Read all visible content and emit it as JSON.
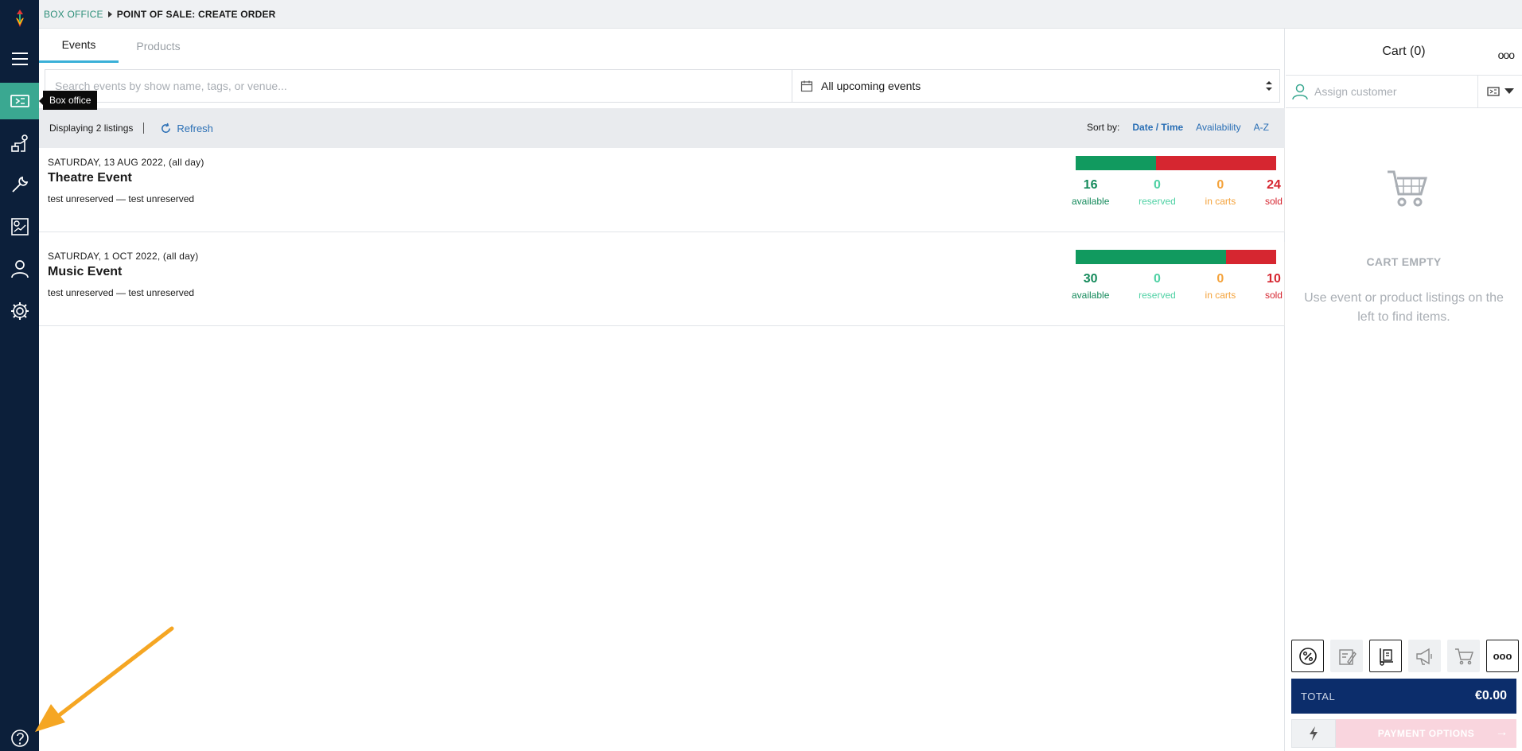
{
  "sidebar": {
    "tooltip": "Box office"
  },
  "breadcrumb": {
    "parent": "BOX OFFICE",
    "current": "POINT OF SALE: CREATE ORDER"
  },
  "tabs": [
    {
      "label": "Events"
    },
    {
      "label": "Products"
    }
  ],
  "search": {
    "placeholder": "Search events by show name, tags, or venue...",
    "value": ""
  },
  "event_filter": {
    "selected": "All upcoming events"
  },
  "listbar": {
    "count_text": "Displaying 2 listings",
    "refresh_label": "Refresh",
    "sort_label": "Sort by:",
    "sort_options": [
      "Date / Time",
      "Availability",
      "A-Z"
    ],
    "sort_active": "Date / Time"
  },
  "events": [
    {
      "date": "SATURDAY, 13 AUG 2022,",
      "time": "(all day)",
      "name": "Theatre Event",
      "venue": "test unreserved — test unreserved",
      "available": "16",
      "reserved": "0",
      "in_carts": "0",
      "sold": "24",
      "available_fraction": 0.4
    },
    {
      "date": "SATURDAY, 1 OCT 2022,",
      "time": "(all day)",
      "name": "Music Event",
      "venue": "test unreserved — test unreserved",
      "available": "30",
      "reserved": "0",
      "in_carts": "0",
      "sold": "10",
      "available_fraction": 0.75
    }
  ],
  "stat_labels": {
    "available": "available",
    "reserved": "reserved",
    "in_carts": "in carts",
    "sold": "sold"
  },
  "cart": {
    "title": "Cart (0)",
    "more": "ooo",
    "customer_placeholder": "Assign customer",
    "empty_title": "CART EMPTY",
    "empty_text": "Use event or product listings on the left to find items.",
    "total_label": "TOTAL",
    "total_value": "€0.00",
    "pay_label": "PAYMENT OPTIONS",
    "tool_more": "ooo"
  },
  "colors": {
    "sidebar": "#0c1f3a",
    "accent": "#3aa891",
    "available": "#119a5f",
    "sold": "#d62630",
    "total_bg": "#0c2d6b",
    "annotation": "#f5a623"
  },
  "icons": [
    "logo-icon",
    "menu-icon",
    "ticket-icon",
    "pos-icon",
    "tools-icon",
    "reports-icon",
    "user-icon",
    "gear-icon",
    "help-icon",
    "calendar-icon",
    "refresh-icon",
    "cart-icon",
    "percent-icon",
    "note-icon",
    "trolley-icon",
    "megaphone-icon",
    "bolt-icon"
  ]
}
